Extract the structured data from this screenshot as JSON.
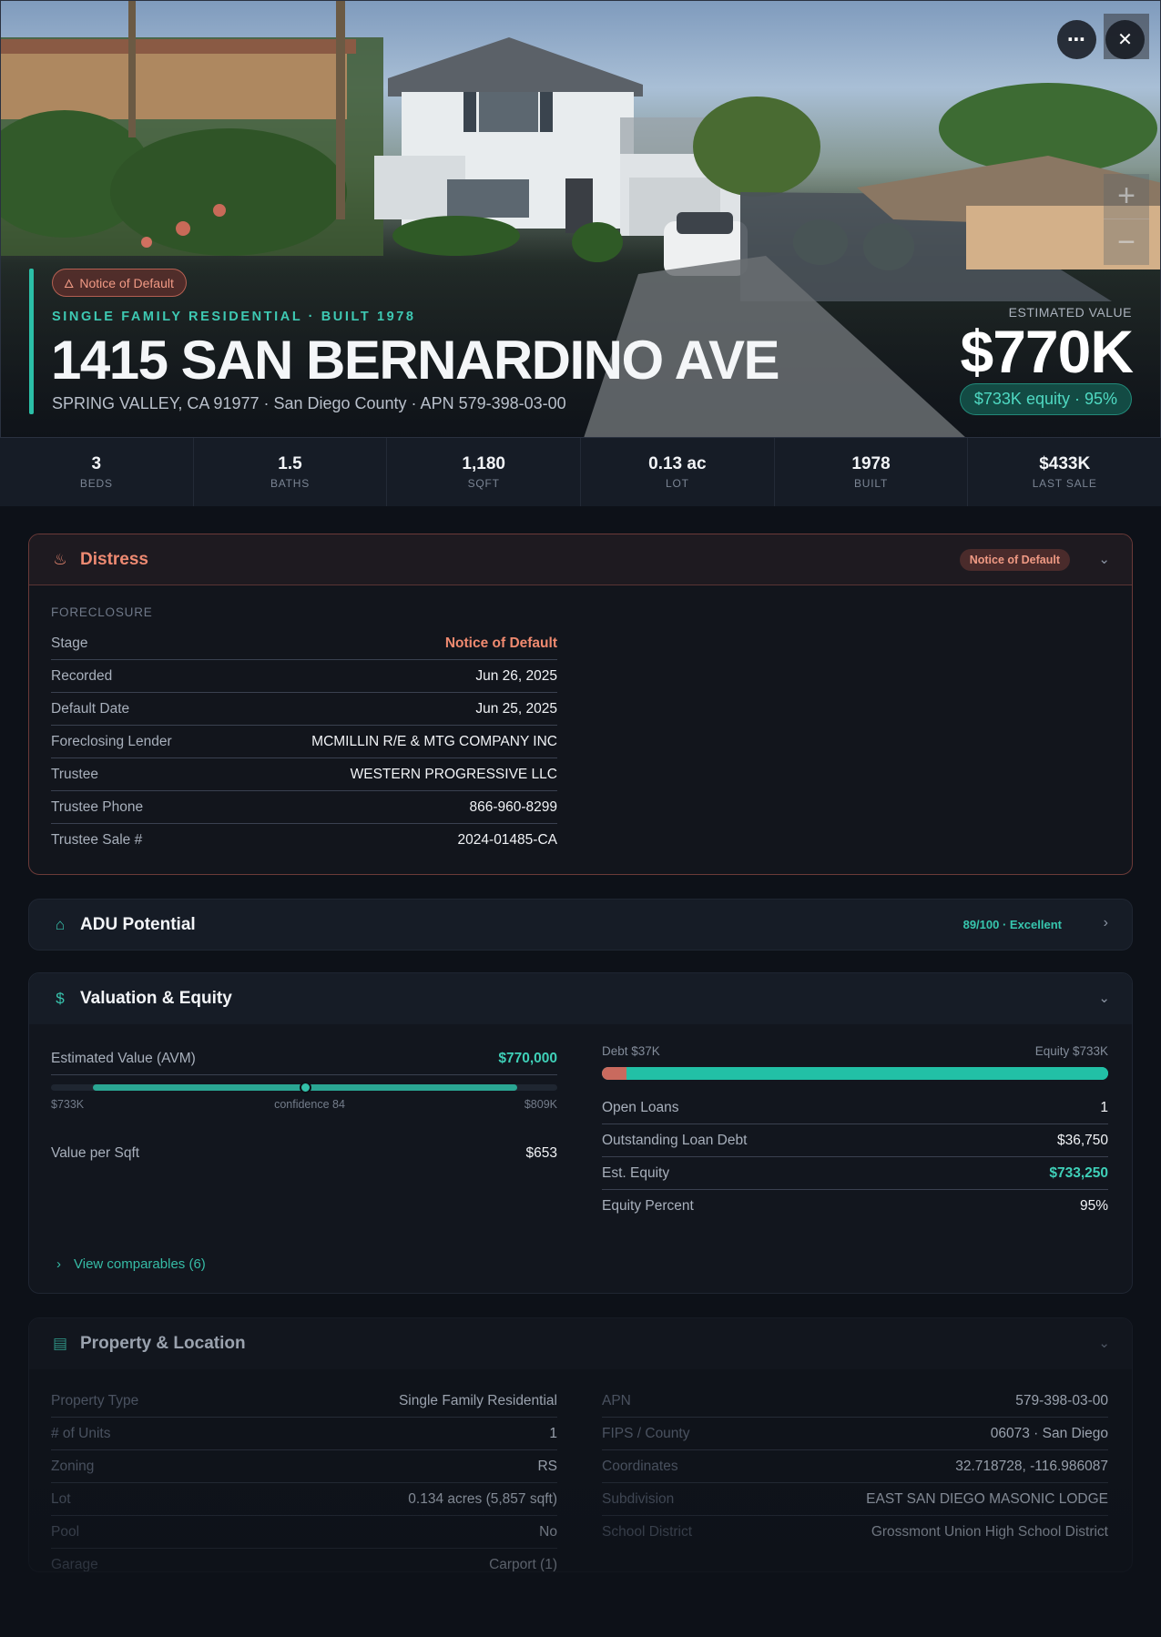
{
  "hero": {
    "status_pill": "Notice of Default",
    "property_type_line": "SINGLE FAMILY RESIDENTIAL · BUILT 1978",
    "address": "1415 SAN BERNARDINO AVE",
    "location_line": "SPRING VALLEY, CA 91977 · San Diego County · APN 579-398-03-00",
    "estimated_value_label": "ESTIMATED VALUE",
    "estimated_value": "$770K",
    "equity_pill": "$733K equity · 95%",
    "buttons": {
      "more_icon": "ellipsis-icon",
      "close_icon": "close-icon",
      "zoom_in": "+",
      "zoom_out": "−"
    }
  },
  "stats": [
    {
      "value": "3",
      "label": "BEDS"
    },
    {
      "value": "1.5",
      "label": "BATHS"
    },
    {
      "value": "1,180",
      "label": "SQFT"
    },
    {
      "value": "0.13 ac",
      "label": "LOT"
    },
    {
      "value": "1978",
      "label": "BUILT"
    },
    {
      "value": "$433K",
      "label": "LAST SALE"
    }
  ],
  "distress": {
    "title": "Distress",
    "icon": "flame-icon",
    "badge": "Notice of Default",
    "section_label": "FORECLOSURE",
    "rows": [
      {
        "k": "Stage",
        "v": "Notice of Default"
      },
      {
        "k": "Recorded",
        "v": "Jun 26, 2025"
      },
      {
        "k": "Default Date",
        "v": "Jun 25, 2025"
      },
      {
        "k": "Foreclosing Lender",
        "v": "MCMILLIN R/E & MTG COMPANY INC"
      },
      {
        "k": "Trustee",
        "v": "WESTERN PROGRESSIVE LLC"
      },
      {
        "k": "Trustee Phone",
        "v": "866-960-8299"
      },
      {
        "k": "Trustee Sale #",
        "v": "2024-01485-CA"
      }
    ]
  },
  "adu": {
    "title": "ADU Potential",
    "icon": "home-icon",
    "score": "89/100 · Excellent"
  },
  "valuation": {
    "title": "Valuation & Equity",
    "icon": "dollar-icon",
    "avm_label": "Estimated Value (AVM)",
    "avm_value": "$770,000",
    "range_low": "$733K",
    "range_mid": "confidence 84",
    "range_high": "$809K",
    "avm_position": 0.5,
    "value_per_sqft_label": "Value per Sqft",
    "value_per_sqft": "$653",
    "debt_label": "Debt $37K",
    "equity_label": "Equity $733K",
    "debt_fraction": 0.048,
    "rows": [
      {
        "k": "Open Loans",
        "v": "1"
      },
      {
        "k": "Outstanding Loan Debt",
        "v": "$36,750"
      },
      {
        "k": "Est. Equity",
        "v": "$733,250"
      },
      {
        "k": "Equity Percent",
        "v": "95%"
      }
    ],
    "comparables_link": "View comparables (6)"
  },
  "property": {
    "title": "Property & Location",
    "icon": "building-icon",
    "left": [
      {
        "k": "Property Type",
        "v": "Single Family Residential"
      },
      {
        "k": "# of Units",
        "v": "1"
      },
      {
        "k": "Zoning",
        "v": "RS"
      },
      {
        "k": "Lot",
        "v": "0.134 acres (5,857 sqft)"
      },
      {
        "k": "Pool",
        "v": "No"
      },
      {
        "k": "Garage",
        "v": "Carport (1)"
      }
    ],
    "right": [
      {
        "k": "APN",
        "v": "579-398-03-00"
      },
      {
        "k": "FIPS / County",
        "v": "06073 · San Diego"
      },
      {
        "k": "Coordinates",
        "v": "32.718728, -116.986087"
      },
      {
        "k": "Subdivision",
        "v": "EAST SAN DIEGO MASONIC LODGE"
      },
      {
        "k": "School District",
        "v": "Grossmont Union High School District"
      }
    ]
  }
}
